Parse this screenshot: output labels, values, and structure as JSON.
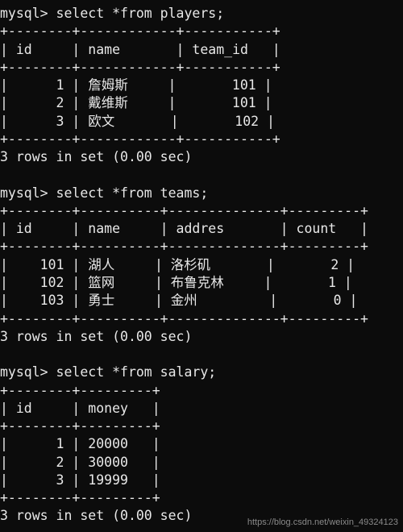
{
  "prompt": "mysql>",
  "queries": [
    {
      "sql": "select *from players;",
      "cols": [
        "id",
        "name",
        "team_id"
      ],
      "widths": [
        6,
        10,
        9
      ],
      "aligns": [
        "r",
        "l",
        "r"
      ],
      "rows": [
        [
          "1",
          "詹姆斯",
          "101"
        ],
        [
          "2",
          "戴维斯",
          "101"
        ],
        [
          "3",
          "欧文",
          "102"
        ]
      ],
      "footer": "3 rows in set (0.00 sec)"
    },
    {
      "sql": "select *from teams;",
      "cols": [
        "id",
        "name",
        "addres",
        "count"
      ],
      "widths": [
        6,
        8,
        12,
        7
      ],
      "aligns": [
        "r",
        "l",
        "l",
        "r"
      ],
      "rows": [
        [
          "101",
          "湖人",
          "洛杉矶",
          "2"
        ],
        [
          "102",
          "篮网",
          "布鲁克林",
          "1"
        ],
        [
          "103",
          "勇士",
          "金州",
          "0"
        ]
      ],
      "footer": "3 rows in set (0.00 sec)"
    },
    {
      "sql": "select *from salary;",
      "cols": [
        "id",
        "money"
      ],
      "widths": [
        6,
        7
      ],
      "aligns": [
        "r",
        "l"
      ],
      "rows": [
        [
          "1",
          "20000"
        ],
        [
          "2",
          "30000"
        ],
        [
          "3",
          "19999"
        ]
      ],
      "footer": "3 rows in set (0.00 sec)"
    }
  ],
  "watermark": "https://blog.csdn.net/weixin_49324123"
}
